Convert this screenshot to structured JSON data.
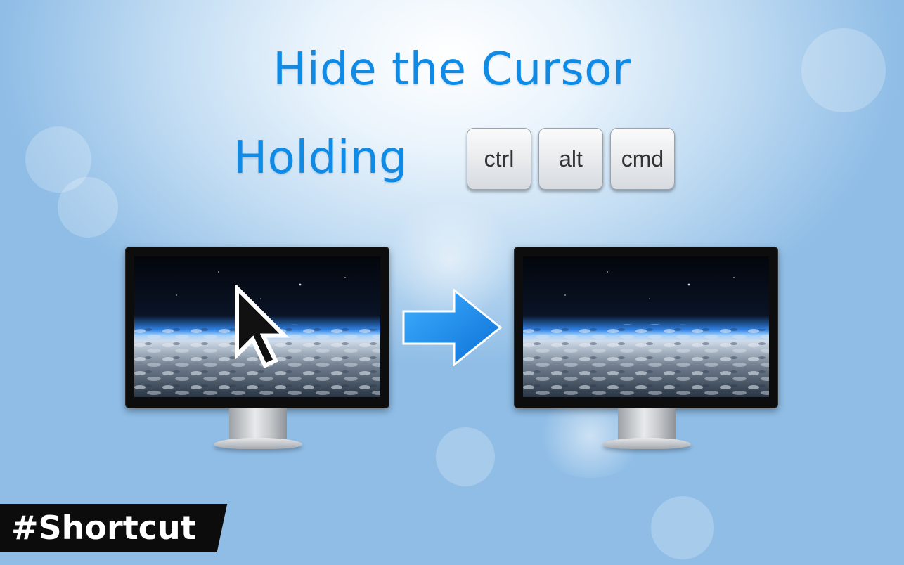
{
  "title_line1": "Hide the Cursor",
  "title_line2": "Holding",
  "keys": [
    "ctrl",
    "alt",
    "cmd"
  ],
  "badge": "#Shortcut",
  "accent_color": "#0f8be6",
  "icons": {
    "arrow": "right-arrow-icon",
    "cursor": "mouse-pointer-icon"
  },
  "monitors": [
    {
      "name": "monitor-with-cursor",
      "cursor_visible": true
    },
    {
      "name": "monitor-without-cursor",
      "cursor_visible": false
    }
  ]
}
